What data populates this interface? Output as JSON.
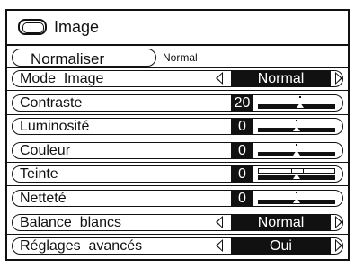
{
  "title": {
    "text": "Image",
    "icon": "picture-icon"
  },
  "normalise": {
    "label": "Normaliser",
    "status": "Normal"
  },
  "rows": [
    {
      "label": "Mode  Image",
      "type": "select",
      "value": "Normal"
    },
    {
      "label": "Contraste",
      "type": "slider",
      "value": "20",
      "level": 0.55
    },
    {
      "label": "Luminosité",
      "type": "slider",
      "value": "0",
      "level": 0.5
    },
    {
      "label": "Couleur",
      "type": "slider",
      "value": "0",
      "level": 0.5
    },
    {
      "label": "Teinte",
      "type": "tint",
      "value": "0",
      "level": 0.5
    },
    {
      "label": "Netteté",
      "type": "slider",
      "value": "0",
      "level": 0.5
    },
    {
      "label": "Balance  blancs",
      "type": "select",
      "value": "Normal"
    },
    {
      "label": "Réglages  avancés",
      "type": "select",
      "value": "Oui"
    }
  ],
  "colors": {
    "foreground": "#111111",
    "background": "#ffffff"
  }
}
